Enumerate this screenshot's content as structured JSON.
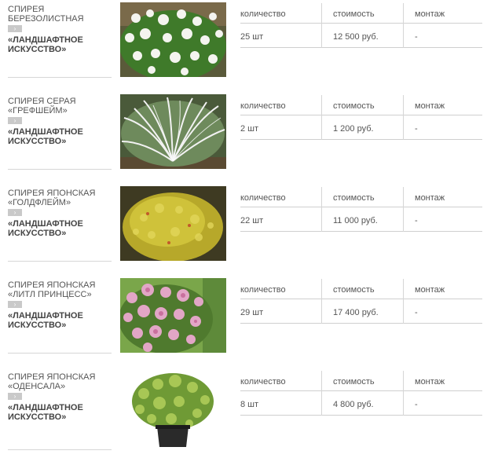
{
  "headers": {
    "qty": "количество",
    "cost": "стоимость",
    "mount": "монтаж"
  },
  "arrow_glyph": "›",
  "items": [
    {
      "name": "СПИРЕЯ БЕРЕЗОЛИСТНАЯ",
      "brand": "«ЛАНДШАФТНОЕ ИСКУССТВО»",
      "qty": "25 шт",
      "cost": "12 500 руб.",
      "mount": "-",
      "photo_icon": "white-spirea-shrub"
    },
    {
      "name": "СПИРЕЯ СЕРАЯ «ГРЕФШЕЙМ»",
      "brand": "«ЛАНДШАФТНОЕ ИСКУССТВО»",
      "qty": "2 шт",
      "cost": "1 200 руб.",
      "mount": "-",
      "photo_icon": "grey-spirea-shrub"
    },
    {
      "name": "СПИРЕЯ ЯПОНСКАЯ «ГОЛДФЛЕЙМ»",
      "brand": "«ЛАНДШАФТНОЕ ИСКУССТВО»",
      "qty": "22 шт",
      "cost": "11 000 руб.",
      "mount": "-",
      "photo_icon": "golden-spirea-shrub"
    },
    {
      "name": "СПИРЕЯ ЯПОНСКАЯ «ЛИТЛ ПРИНЦЕСС»",
      "brand": "«ЛАНДШАФТНОЕ ИСКУССТВО»",
      "qty": "29 шт",
      "cost": "17 400 руб.",
      "mount": "-",
      "photo_icon": "pink-spirea-shrub"
    },
    {
      "name": "СПИРЕЯ ЯПОНСКАЯ «ОДЕНСАЛА»",
      "brand": "«ЛАНДШАФТНОЕ ИСКУССТВО»",
      "qty": "8 шт",
      "cost": "4 800 руб.",
      "mount": "-",
      "photo_icon": "potted-spirea-shrub"
    }
  ]
}
